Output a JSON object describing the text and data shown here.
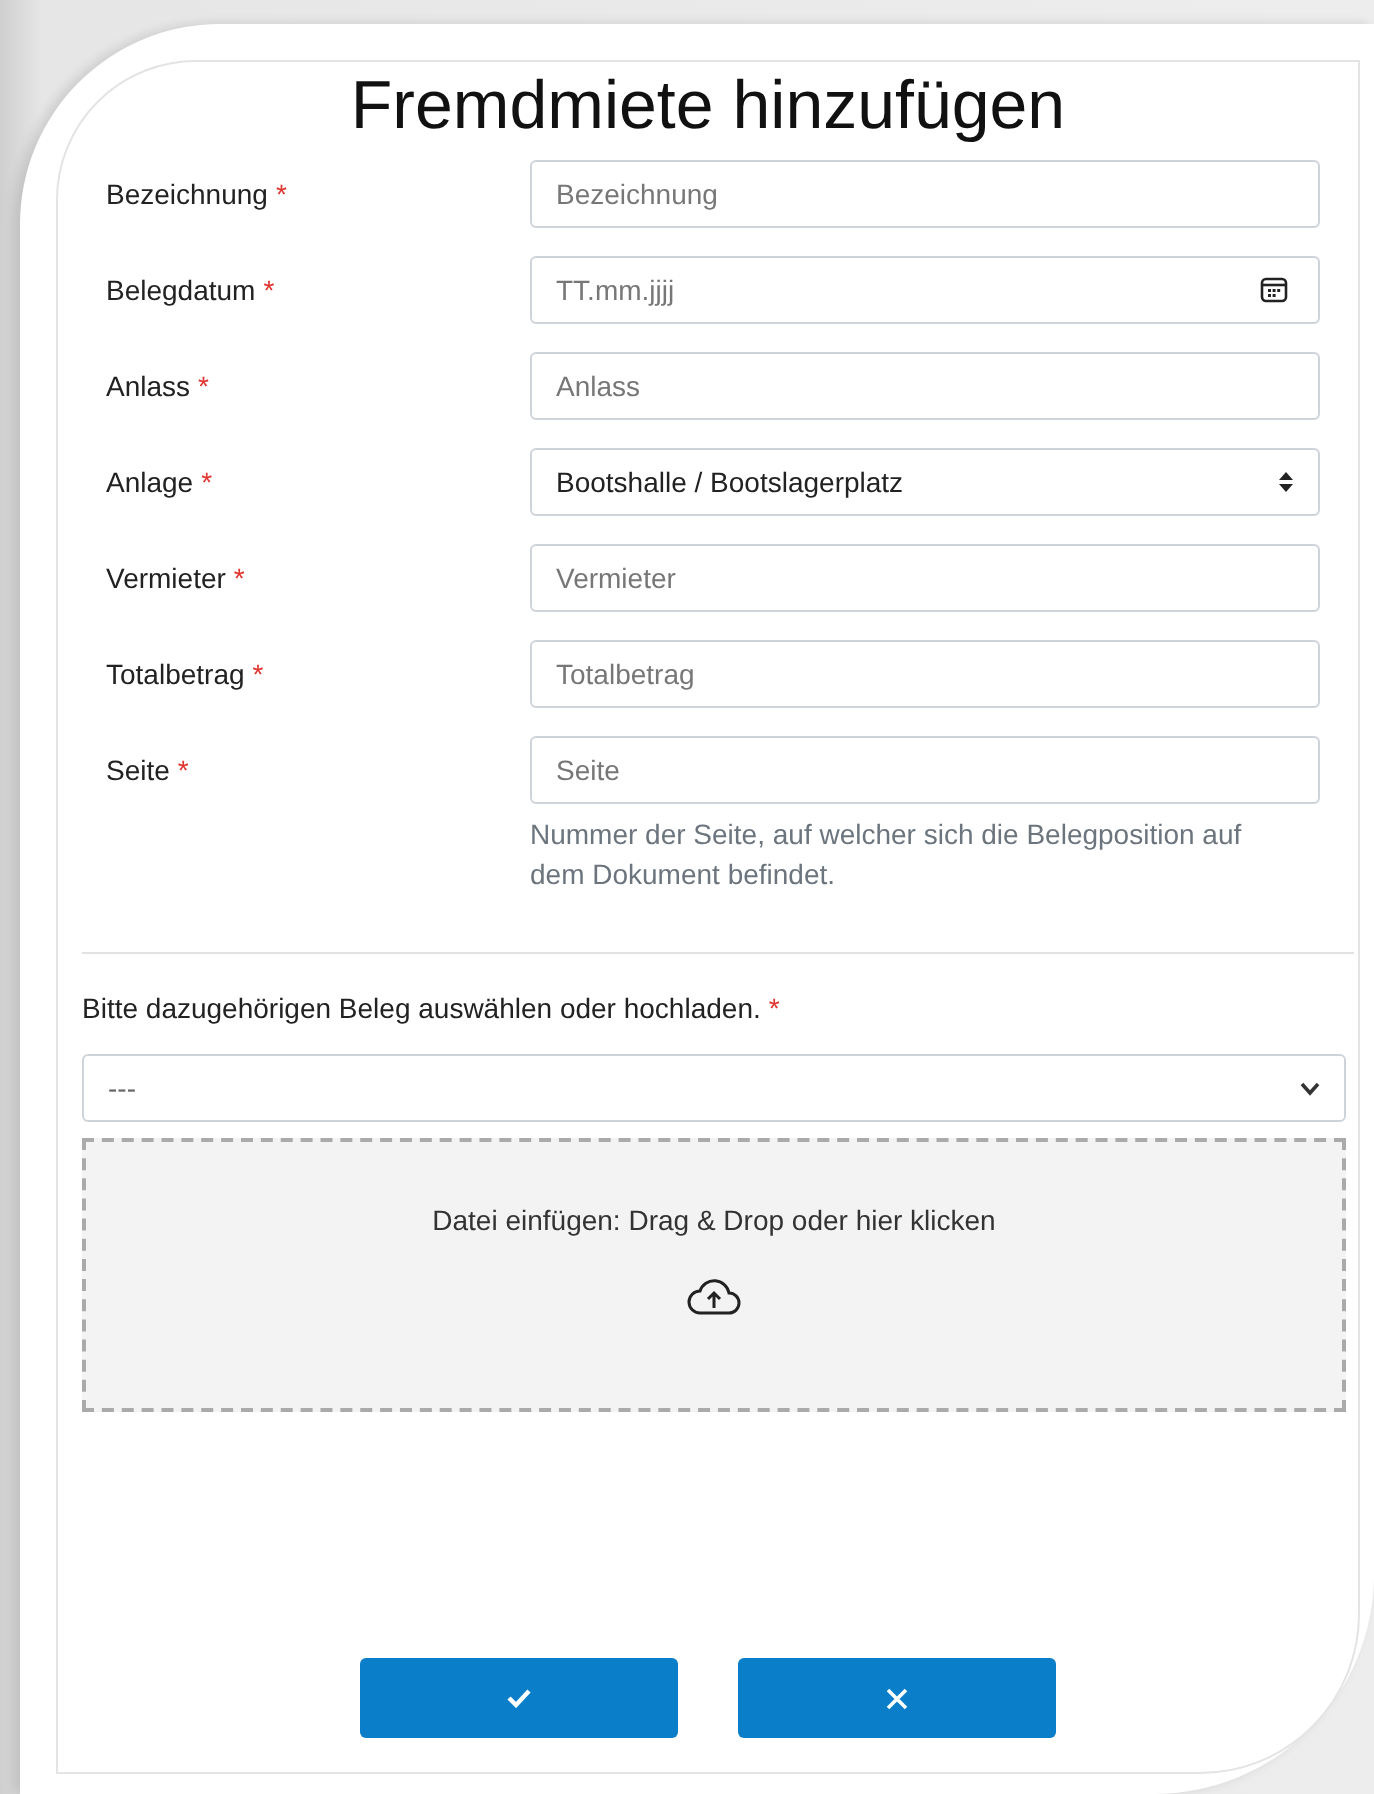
{
  "title": "Fremdmiete hinzufügen",
  "fields": [
    {
      "label": "Bezeichnung",
      "required_mark": "*",
      "kind": "text",
      "placeholder": "Bezeichnung"
    },
    {
      "label": "Belegdatum",
      "required_mark": "*",
      "kind": "date",
      "placeholder": "TT.mm.jjjj"
    },
    {
      "label": "Anlass",
      "required_mark": "*",
      "kind": "text",
      "placeholder": "Anlass"
    },
    {
      "label": "Anlage",
      "required_mark": "*",
      "kind": "select",
      "value": "Bootshalle / Bootslagerplatz"
    },
    {
      "label": "Vermieter",
      "required_mark": "*",
      "kind": "text",
      "placeholder": "Vermieter"
    },
    {
      "label": "Totalbetrag",
      "required_mark": "*",
      "kind": "text",
      "placeholder": "Totalbetrag"
    },
    {
      "label": "Seite",
      "required_mark": "*",
      "kind": "text",
      "placeholder": "Seite",
      "help": "Nummer der Seite, auf welcher sich die Belegposition auf dem Dokument befindet."
    }
  ],
  "upload": {
    "label": "Bitte dazugehörigen Beleg auswählen oder hochladen.",
    "required_mark": "*",
    "select_value": "---",
    "dropzone_text": "Datei einfügen: Drag & Drop oder hier klicken"
  },
  "buttons": [
    {
      "kind": "confirm"
    },
    {
      "kind": "cancel"
    }
  ]
}
